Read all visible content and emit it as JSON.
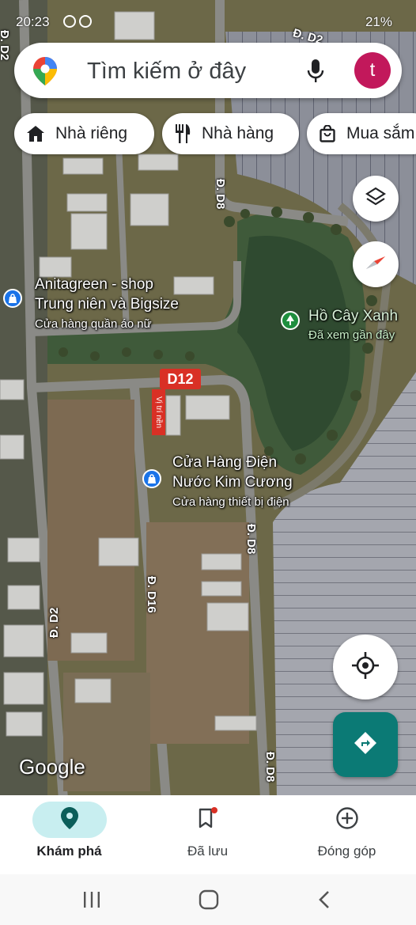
{
  "status_bar": {
    "time": "20:23",
    "battery": "21%"
  },
  "search": {
    "placeholder": "Tìm kiếm ở đây",
    "avatar_letter": "t",
    "avatar_color": "#c2185b"
  },
  "chips": [
    {
      "label": "Nhà riêng",
      "icon": "home-icon"
    },
    {
      "label": "Nhà hàng",
      "icon": "restaurant-icon"
    },
    {
      "label": "Mua sắm",
      "icon": "shopping-bag-icon"
    }
  ],
  "map": {
    "places": [
      {
        "name_line1": "Anitagreen - shop",
        "name_line2": "Trung niên và Bigsize",
        "category": "Cửa hàng quần áo nữ",
        "icon": "shopping-bag-pin-icon"
      },
      {
        "name": "Hồ Cây Xanh",
        "note": "Đã xem gần đây",
        "icon": "tree-pin-icon"
      },
      {
        "name_line1": "Cửa Hàng Điện",
        "name_line2": "Nước Kim Cương",
        "category": "Cửa hàng thiết bị điện",
        "icon": "shopping-bag-pin-icon"
      }
    ],
    "streets": {
      "d8_top": "Đ. D8",
      "d8_mid": "Đ. D8",
      "d8_bottom": "Đ. D8",
      "d16": "Đ. D16",
      "d2_left": "Đ. D2",
      "d2_top": "Đ. D2",
      "d2_topright": "Đ. D2"
    },
    "d12_badge": "D12",
    "vitri_label": "Vị trí nền",
    "attribution": "Google"
  },
  "colors": {
    "accent": "#0b7a75",
    "active_nav_bg": "#c8eef0",
    "pin_blue": "#1a73e8",
    "pin_green": "#1e8e3e",
    "badge_red": "#d93025"
  },
  "bottom_nav": [
    {
      "label": "Khám phá",
      "icon": "explore-pin-icon",
      "active": true
    },
    {
      "label": "Đã lưu",
      "icon": "bookmark-icon",
      "active": false
    },
    {
      "label": "Đóng góp",
      "icon": "add-circle-icon",
      "active": false
    }
  ]
}
